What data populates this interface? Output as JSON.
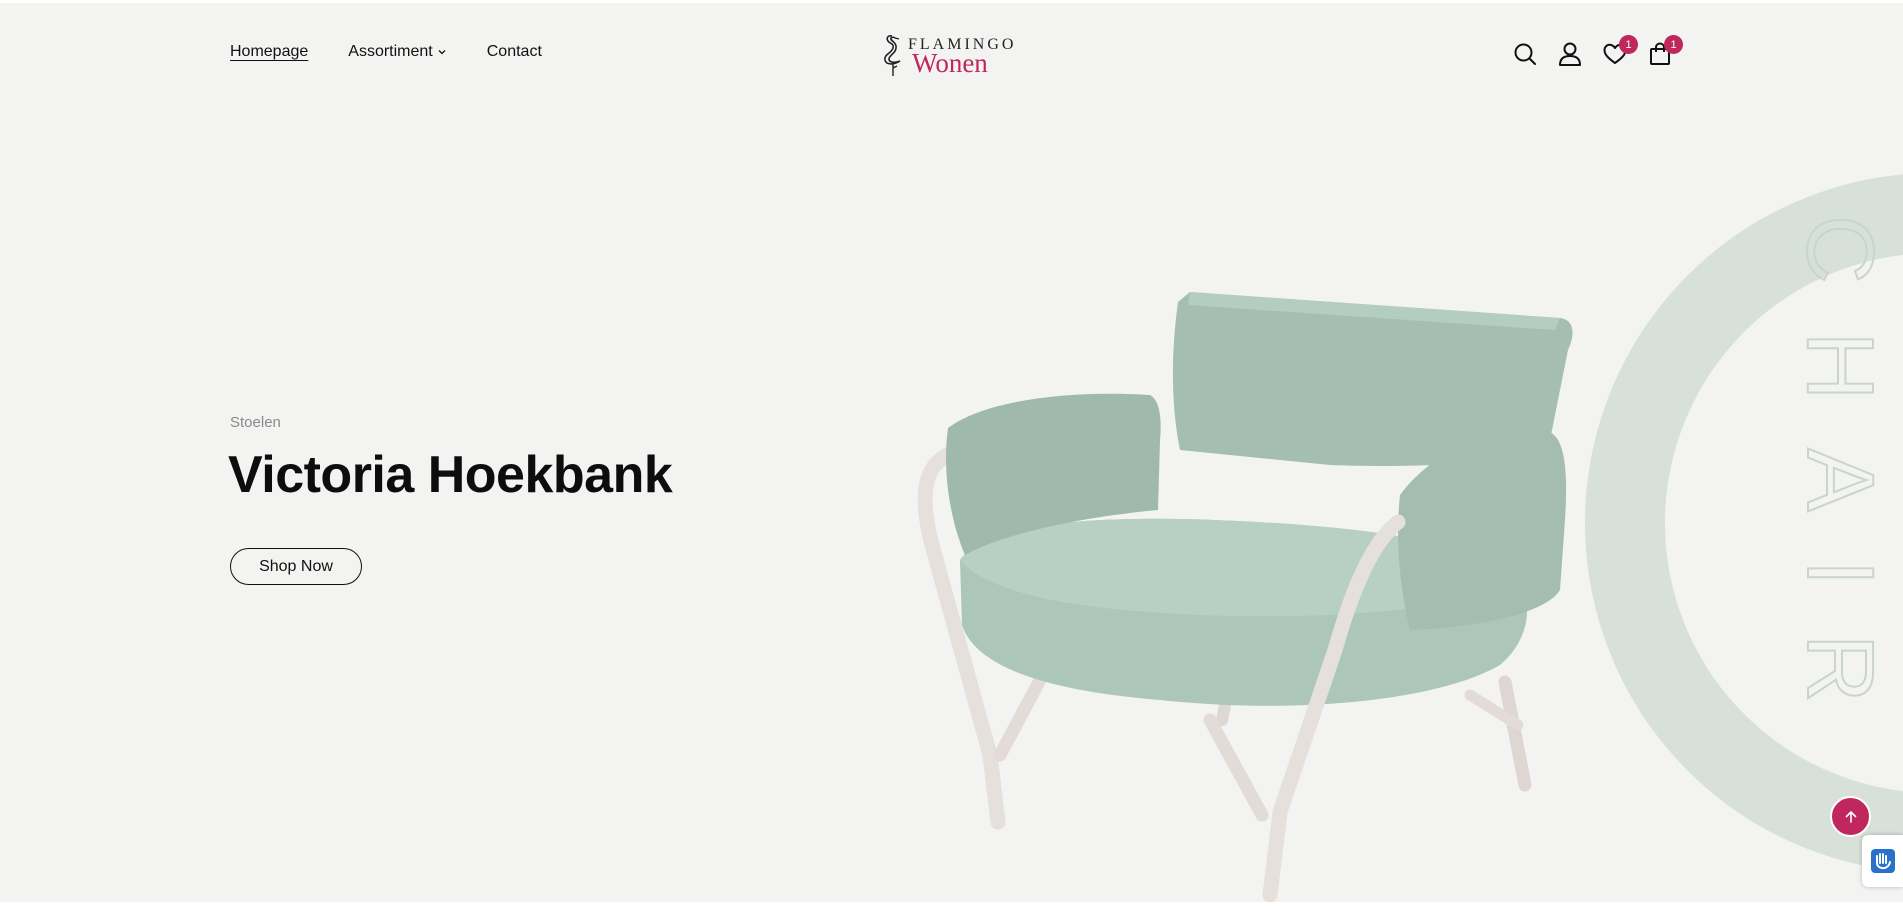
{
  "header": {
    "nav": {
      "homepage": "Homepage",
      "assortment": "Assortiment",
      "contact": "Contact"
    },
    "logo": {
      "line1": "FLAMINGO",
      "line2": "Wonen"
    },
    "icons": {
      "search": "search-icon",
      "account": "user-icon",
      "wishlist": "heart-icon",
      "cart": "shopping-bag-icon"
    },
    "wishlist_count": "1",
    "cart_count": "1"
  },
  "hero": {
    "category": "Stoelen",
    "title": "Victoria Hoekbank",
    "cta": "Shop Now",
    "vertical_word": "CHAIR"
  },
  "colors": {
    "background": "#f3f3f2",
    "accent": "#c0275c",
    "ring": "#d7e1d9",
    "chair_fabric": "#a9c3b7",
    "chair_frame": "#e6e0dd"
  }
}
